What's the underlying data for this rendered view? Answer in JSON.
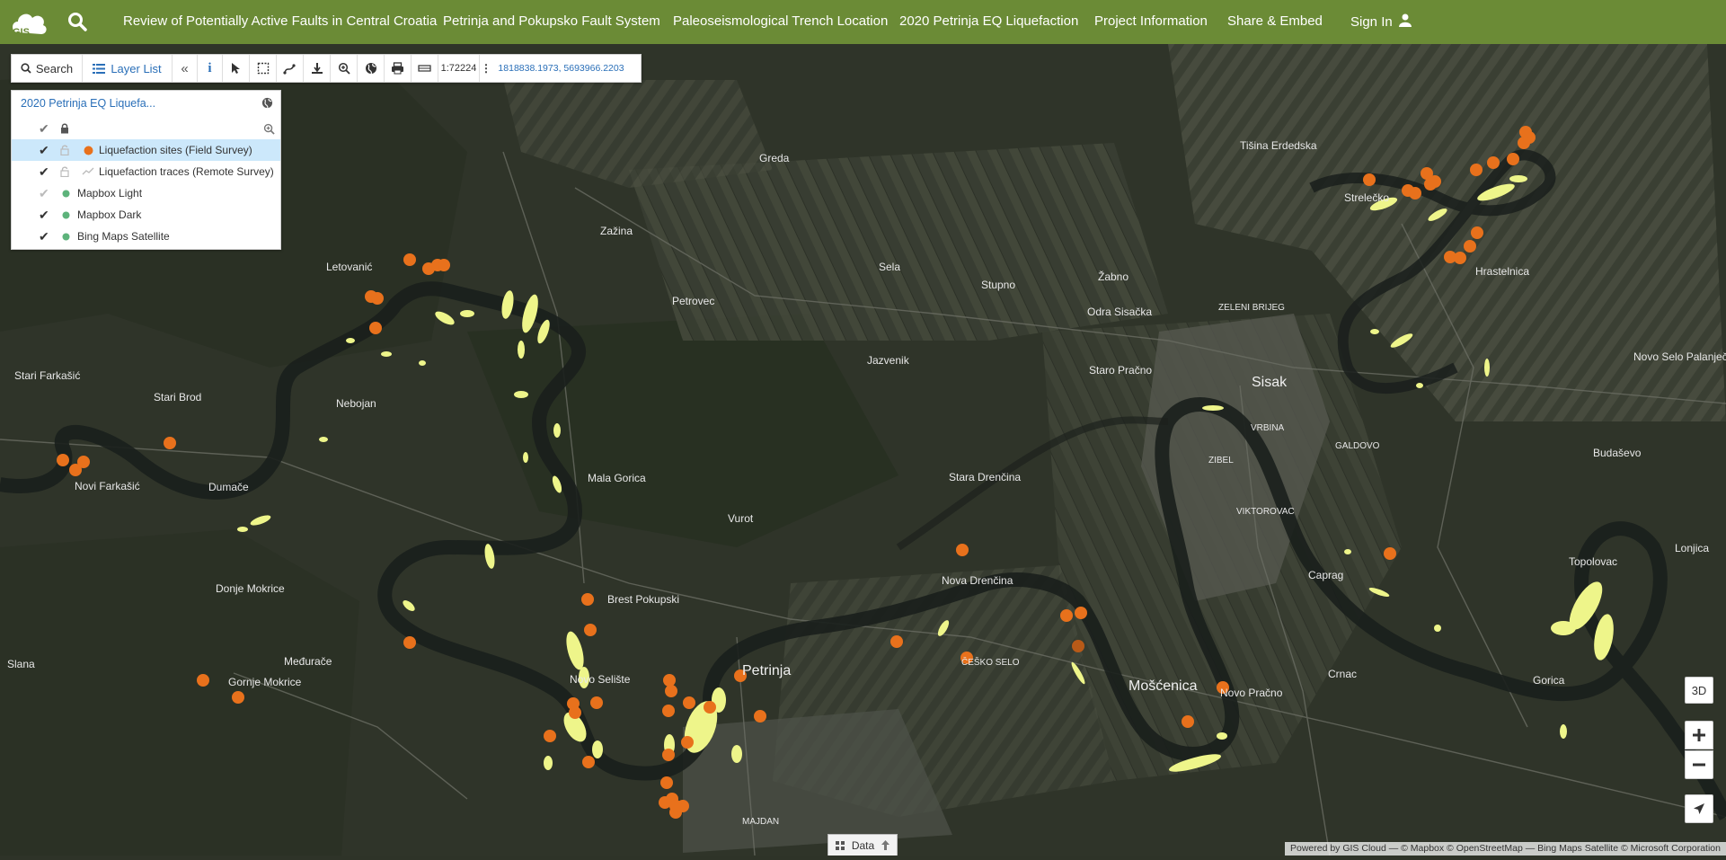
{
  "nav": {
    "links": [
      "Review of Potentially Active Faults in Central Croatia",
      "Petrinja and Pokupsko Fault System",
      "Paleoseismological Trench Location",
      "2020 Petrinja EQ Liquefaction",
      "Project Information",
      "Share & Embed"
    ],
    "sign_in": "Sign In"
  },
  "toolbar": {
    "search_label": "Search",
    "layer_list_label": "Layer List",
    "scale": "1:72224",
    "coordinates": "1818838.1973, 5693966.2203"
  },
  "layers": {
    "title": "2020 Petrinja EQ Liquefa...",
    "items": [
      {
        "name": "Liquefaction sites (Field Survey)",
        "checked": true,
        "selected": true
      },
      {
        "name": "Liquefaction traces (Remote Survey)",
        "checked": true,
        "selected": false
      },
      {
        "name": "Mapbox Light",
        "checked": false,
        "selected": false
      },
      {
        "name": "Mapbox Dark",
        "checked": true,
        "selected": false
      },
      {
        "name": "Bing Maps Satellite",
        "checked": true,
        "selected": false
      }
    ]
  },
  "map_labels": {
    "greda": "Greda",
    "zazina": "Zažina",
    "letovanic": "Letovanić",
    "petrovec": "Petrovec",
    "sela": "Sela",
    "stupno": "Stupno",
    "zabno": "Žabno",
    "odra": "Odra Sisačka",
    "stari_farkasic": "Stari Farkašić",
    "stari_brod": "Stari Brod",
    "nebojan": "Nebojan",
    "jazvenik": "Jazvenik",
    "staro_pracno": "Staro Pračno",
    "sisak": "Sisak",
    "novi_farkasic": "Novi Farkašić",
    "dumace": "Dumače",
    "mala_gorica": "Mala Gorica",
    "vurot": "Vurot",
    "stara_drencina": "Stara Drenčina",
    "nova_drencina": "Nova Drenčina",
    "donje_mokrice": "Donje Mokrice",
    "brest_pokupski": "Brest Pokupski",
    "slana": "Slana",
    "meduracje": "Međurače",
    "gornje_mokrice": "Gornje Mokrice",
    "novo_selisce": "Novo Selište",
    "petrinja": "Petrinja",
    "moscenica": "Mošćenica",
    "novo_pracno": "Novo Pračno",
    "crnac": "Crnac",
    "caprag": "Caprag",
    "hrastelnica": "Hrastelnica",
    "budasevo": "Budaševo",
    "topolovac": "Topolovac",
    "lonjica": "Lonjica",
    "novo_selo_palanjecko": "Novo Selo Palanječko",
    "tisina_erdedska": "Tišina Erdedska",
    "strelecko": "Strelečko",
    "vrbina": "VRBINA",
    "zibel": "ZIBEL",
    "viktorovac": "VIKTOROVAC",
    "zeleni_brijeg": "ZELENI BRIJEG",
    "galdovo": "GALDOVO",
    "ceski_selo": "ČEŠKO SELO",
    "majdan": "MAJDAN",
    "gorica": "Gorica"
  },
  "controls": {
    "btn_3d": "3D",
    "data_tab": "Data"
  },
  "attribution": "Powered by GIS Cloud — © Mapbox © OpenStreetMap — Bing Maps Satellite © Microsoft Corporation",
  "colors": {
    "nav_bg": "#6b8b36",
    "site_marker": "#e8711c",
    "trace": "#eef58a",
    "selected_row": "#cce8fb",
    "link": "#2a6fb8"
  }
}
